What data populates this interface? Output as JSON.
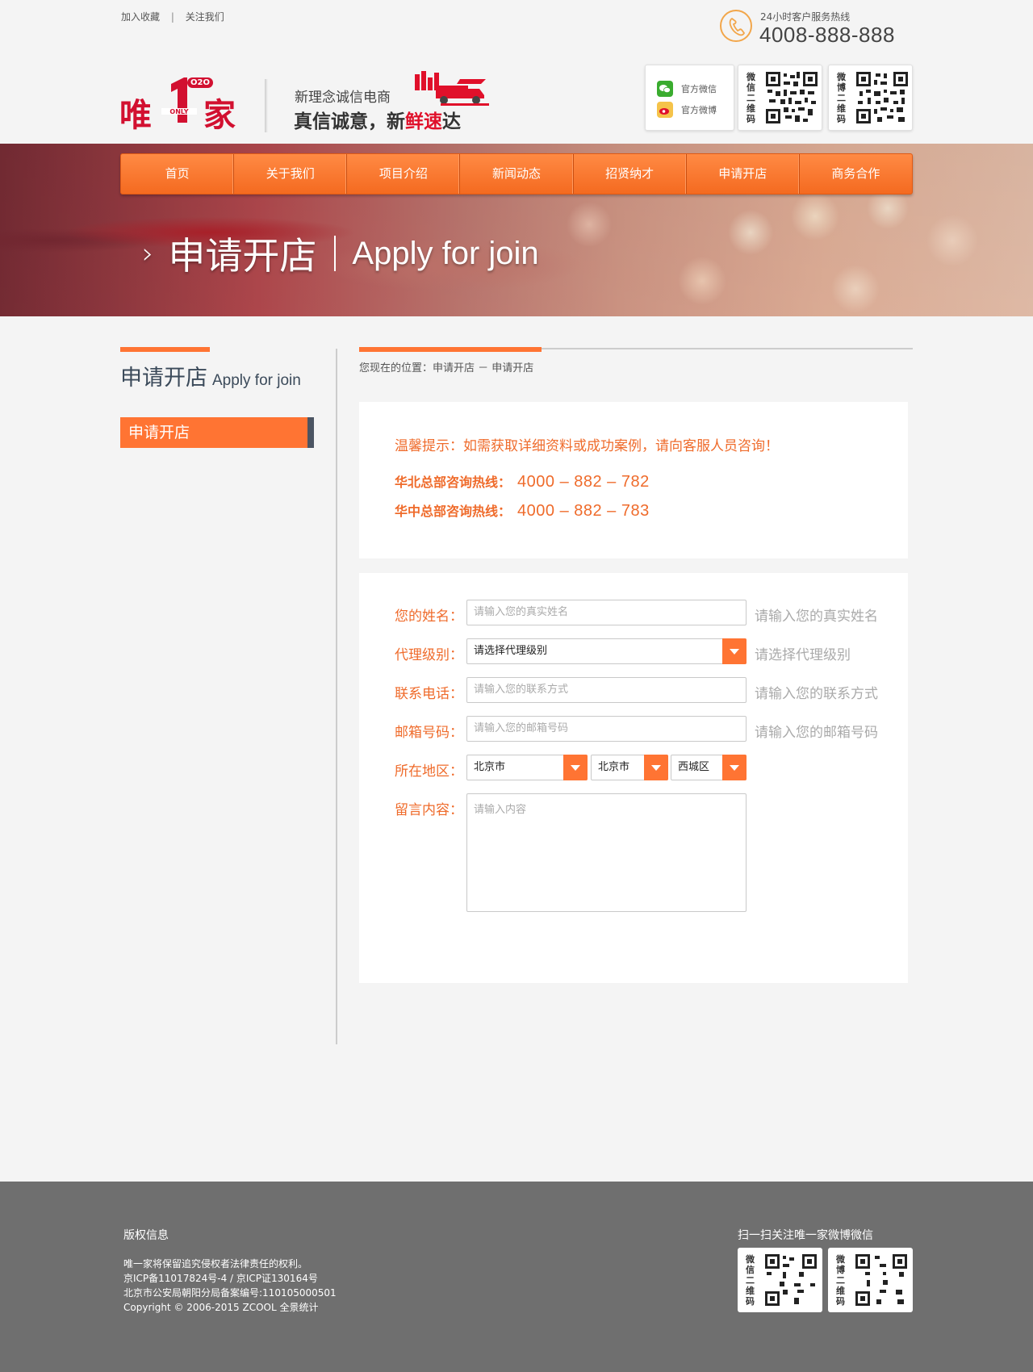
{
  "topbar": {
    "links": [
      "加入收藏",
      "关注我们"
    ],
    "separator": "|",
    "hotline_label": "24小时客户服务热线",
    "hotline_number": "4008-888-888"
  },
  "brand": {
    "logo_left": "唯",
    "logo_right": "家",
    "logo_badge": "O2O",
    "slogan_line1": "新理念诚信电商",
    "slogan_line2_a": "真信诚意，新",
    "slogan_line2_red": "鲜速",
    "slogan_line2_b": "达"
  },
  "social": {
    "wechat_label": "官方微信",
    "weibo_label": "官方微博",
    "qr_wechat_label": "微信二维码",
    "qr_weibo_label": "微博二维码"
  },
  "nav": {
    "items": [
      "首页",
      "关于我们",
      "项目介绍",
      "新闻动态",
      "招贤纳才",
      "申请开店",
      "商务合作"
    ]
  },
  "banner": {
    "arrow": "›",
    "title_cn": "申请开店",
    "title_en": "Apply for join"
  },
  "sidebar": {
    "title_cn": "申请开店",
    "title_en": "Apply for join",
    "items": [
      "申请开店"
    ]
  },
  "breadcrumb": "您现在的位置：申请开店 － 申请开店",
  "tips": {
    "text": "温馨提示：如需获取详细资料或成功案例，请向客服人员咨询！",
    "hotline1_label": "华北总部咨询热线：",
    "hotline1_number": "4000 – 882 – 782",
    "hotline2_label": "华中总部咨询热线：",
    "hotline2_number": "4000 – 882 – 783"
  },
  "form": {
    "name": {
      "label": "您的姓名：",
      "placeholder": "请输入您的真实姓名",
      "hint": "请输入您的真实姓名"
    },
    "level": {
      "label": "代理级别：",
      "value": "请选择代理级别",
      "hint": "请选择代理级别"
    },
    "phone": {
      "label": "联系电话：",
      "placeholder": "请输入您的联系方式",
      "hint": "请输入您的联系方式"
    },
    "email": {
      "label": "邮箱号码：",
      "placeholder": "请输入您的邮箱号码",
      "hint": "请输入您的邮箱号码"
    },
    "region": {
      "label": "所在地区：",
      "province": "北京市",
      "city": "北京市",
      "district": "西城区"
    },
    "message": {
      "label": "留言内容：",
      "placeholder": "请输入内容"
    }
  },
  "footer": {
    "title": "版权信息",
    "lines": [
      "唯一家将保留追究侵权者法律责任的权利。",
      "京ICP备11017824号-4 / 京ICP证130164号",
      "北京市公安局朝阳分局备案编号:110105000501",
      "Copyright © 2006-2015 ZCOOL 全景统计"
    ],
    "scan_title": "扫一扫关注唯一家微博微信"
  },
  "colors": {
    "accent": "#ff7433",
    "brand_red": "#d21030",
    "footer_bg": "#6f6f6f"
  }
}
